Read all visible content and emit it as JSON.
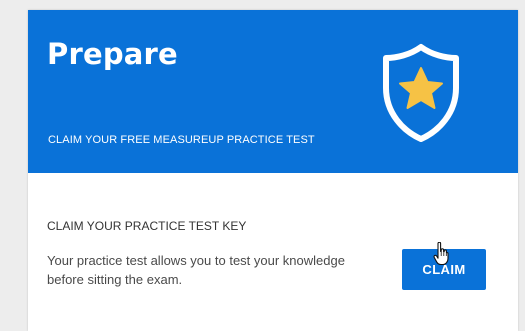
{
  "colors": {
    "brand_blue": "#0a72d8",
    "accent_yellow": "#f6c245",
    "page_bg": "#ededed"
  },
  "hero": {
    "title": "Prepare",
    "subtitle": "CLAIM YOUR FREE MEASUREUP PRACTICE TEST",
    "icon": "shield-star-icon"
  },
  "claim": {
    "heading": "CLAIM YOUR PRACTICE TEST KEY",
    "description": "Your practice test allows you to test your knowledge before sitting the exam.",
    "button_label": "CLAIM"
  },
  "cursor": {
    "icon": "hand-pointer-icon"
  }
}
